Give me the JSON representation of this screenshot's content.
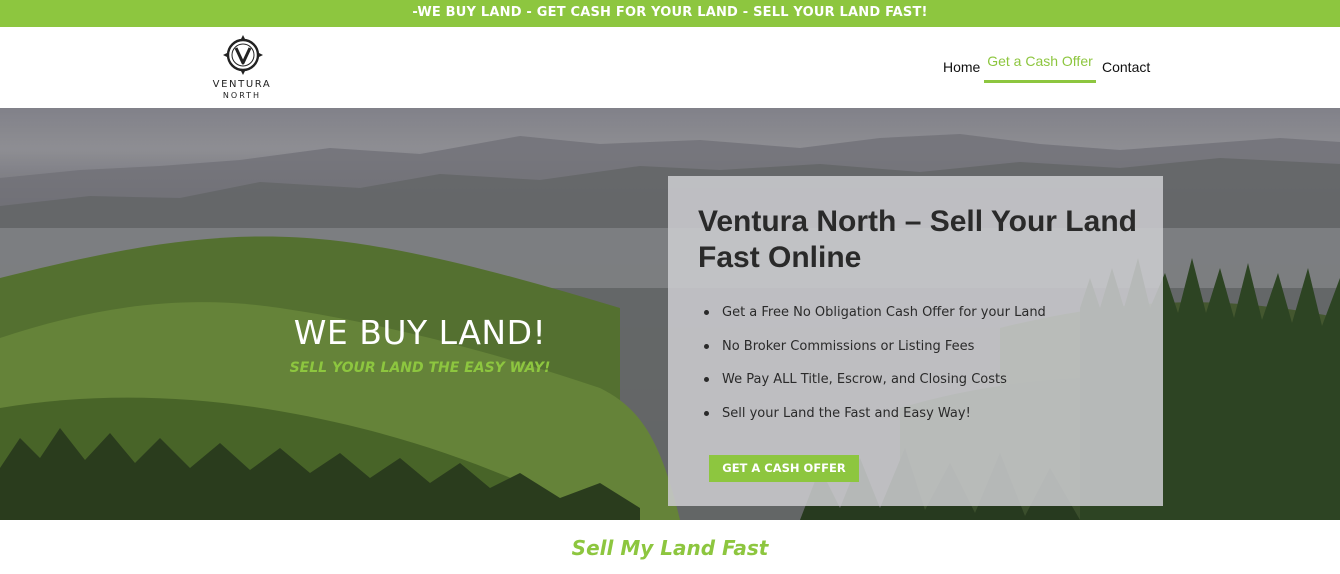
{
  "topbar": {
    "text": "-WE BUY LAND - GET CASH FOR YOUR LAND - SELL YOUR LAND FAST!"
  },
  "logo": {
    "name": "VENTURA",
    "sub": "NORTH",
    "icon": "compass-v-logo-icon"
  },
  "nav": {
    "home": "Home",
    "offer": "Get a Cash Offer",
    "contact": "Contact",
    "active": "Get a Cash Offer"
  },
  "hero": {
    "title": "WE BUY LAND!",
    "subtitle": "SELL YOUR LAND THE EASY WAY!"
  },
  "card": {
    "title": "Ventura North – Sell Your Land Fast Online",
    "bullets": [
      "Get a Free No Obligation Cash Offer for your Land",
      "No Broker Commissions or Listing Fees",
      "We Pay ALL Title, Escrow, and Closing Costs",
      "Sell your Land the Fast and Easy Way!"
    ],
    "cta": "GET A CASH OFFER"
  },
  "section": {
    "heading": "Sell My Land Fast"
  },
  "colors": {
    "accent": "#8dc63f",
    "text": "#2a2a2a",
    "white": "#ffffff"
  }
}
